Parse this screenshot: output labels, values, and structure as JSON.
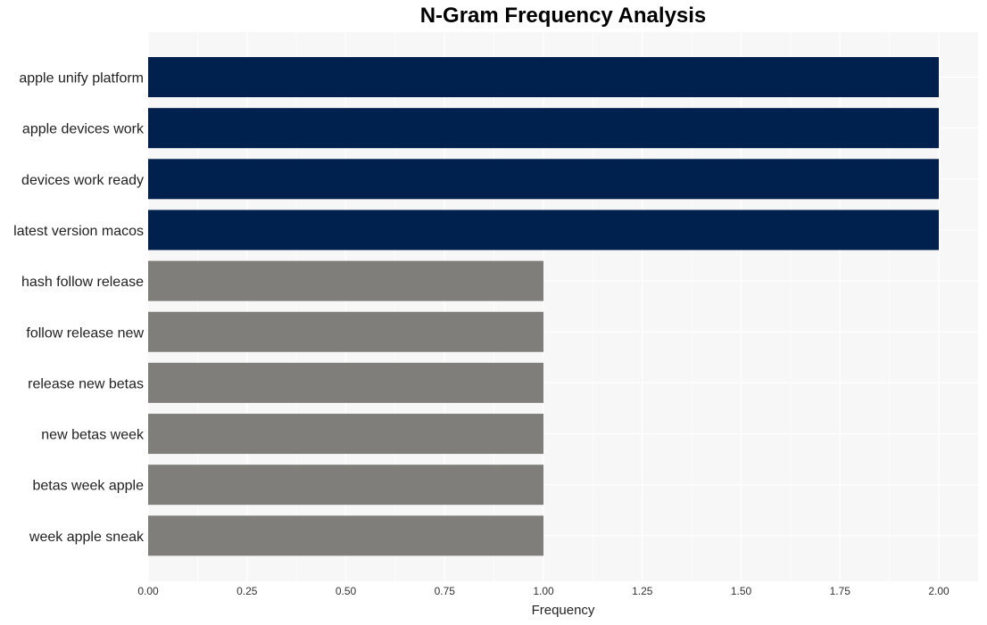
{
  "chart_data": {
    "type": "bar",
    "orientation": "horizontal",
    "title": "N-Gram Frequency Analysis",
    "xlabel": "Frequency",
    "ylabel": "",
    "xlim": [
      0,
      2.1
    ],
    "grid": true,
    "x_ticks": [
      "0.00",
      "0.25",
      "0.50",
      "0.75",
      "1.00",
      "1.25",
      "1.50",
      "1.75",
      "2.00"
    ],
    "x_tick_values": [
      0,
      0.25,
      0.5,
      0.75,
      1.0,
      1.25,
      1.5,
      1.75,
      2.0
    ],
    "categories": [
      "apple unify platform",
      "apple devices work",
      "devices work ready",
      "latest version macos",
      "hash follow release",
      "follow release new",
      "release new betas",
      "new betas week",
      "betas week apple",
      "week apple sneak"
    ],
    "values": [
      2,
      2,
      2,
      2,
      1,
      1,
      1,
      1,
      1,
      1
    ],
    "colors": {
      "high": "#00214d",
      "low": "#7f7e7a",
      "panel_background": "#f7f7f7",
      "grid": "#ffffff"
    }
  }
}
